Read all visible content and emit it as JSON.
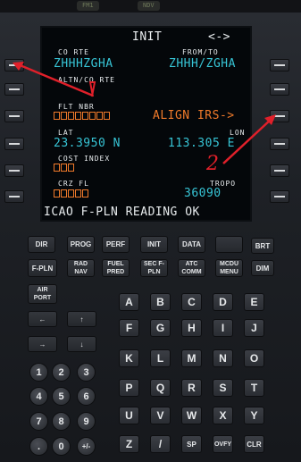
{
  "annunciators": [
    "FM1",
    "NDV"
  ],
  "screen": {
    "title": "INIT",
    "arrows": "<->",
    "co_rte_label": "CO RTE",
    "co_rte_value": "ZHHHZGHA",
    "from_to_label": "FROM/TO",
    "from_to_value": "ZHHH/ZGHA",
    "altn_label": "ALTN/CO RTE",
    "flt_nbr_label": "FLT NBR",
    "align_irs": "ALIGN IRS->",
    "lat_label": "LAT",
    "lat_value": "23.3950 N",
    "lon_label": "LON",
    "lon_value": "113.305 E",
    "cost_index_label": "COST INDEX",
    "crz_fl_label": "CRZ FL",
    "tropo_label": "TROPO",
    "tropo_value": "36090",
    "scratchpad": "ICAO F-PLN READING OK"
  },
  "function_keys": {
    "row1": [
      "DIR",
      "PROG",
      "PERF",
      "INIT",
      "DATA",
      "",
      "BRT"
    ],
    "row2": [
      "F-PLN",
      "RAD NAV",
      "FUEL PRED",
      "SEC F-PLN",
      "ATC COMM",
      "MCDU MENU",
      "DIM"
    ],
    "airport": "AIR PORT"
  },
  "alpha_keys": [
    "A",
    "B",
    "C",
    "D",
    "E",
    "F",
    "G",
    "H",
    "I",
    "J",
    "K",
    "L",
    "M",
    "N",
    "O",
    "P",
    "Q",
    "R",
    "S",
    "T",
    "U",
    "V",
    "W",
    "X",
    "Y",
    "Z",
    "/",
    "SP",
    "OVFY",
    "CLR"
  ],
  "num_keys": [
    "1",
    "2",
    "3",
    "4",
    "5",
    "6",
    "7",
    "8",
    "9",
    ".",
    "0",
    "+/-"
  ],
  "annotation": {
    "handwritten": "2"
  },
  "colors": {
    "cyan": "#37c5d6",
    "orange": "#f07a2a",
    "annotation_red": "#e0202a"
  }
}
